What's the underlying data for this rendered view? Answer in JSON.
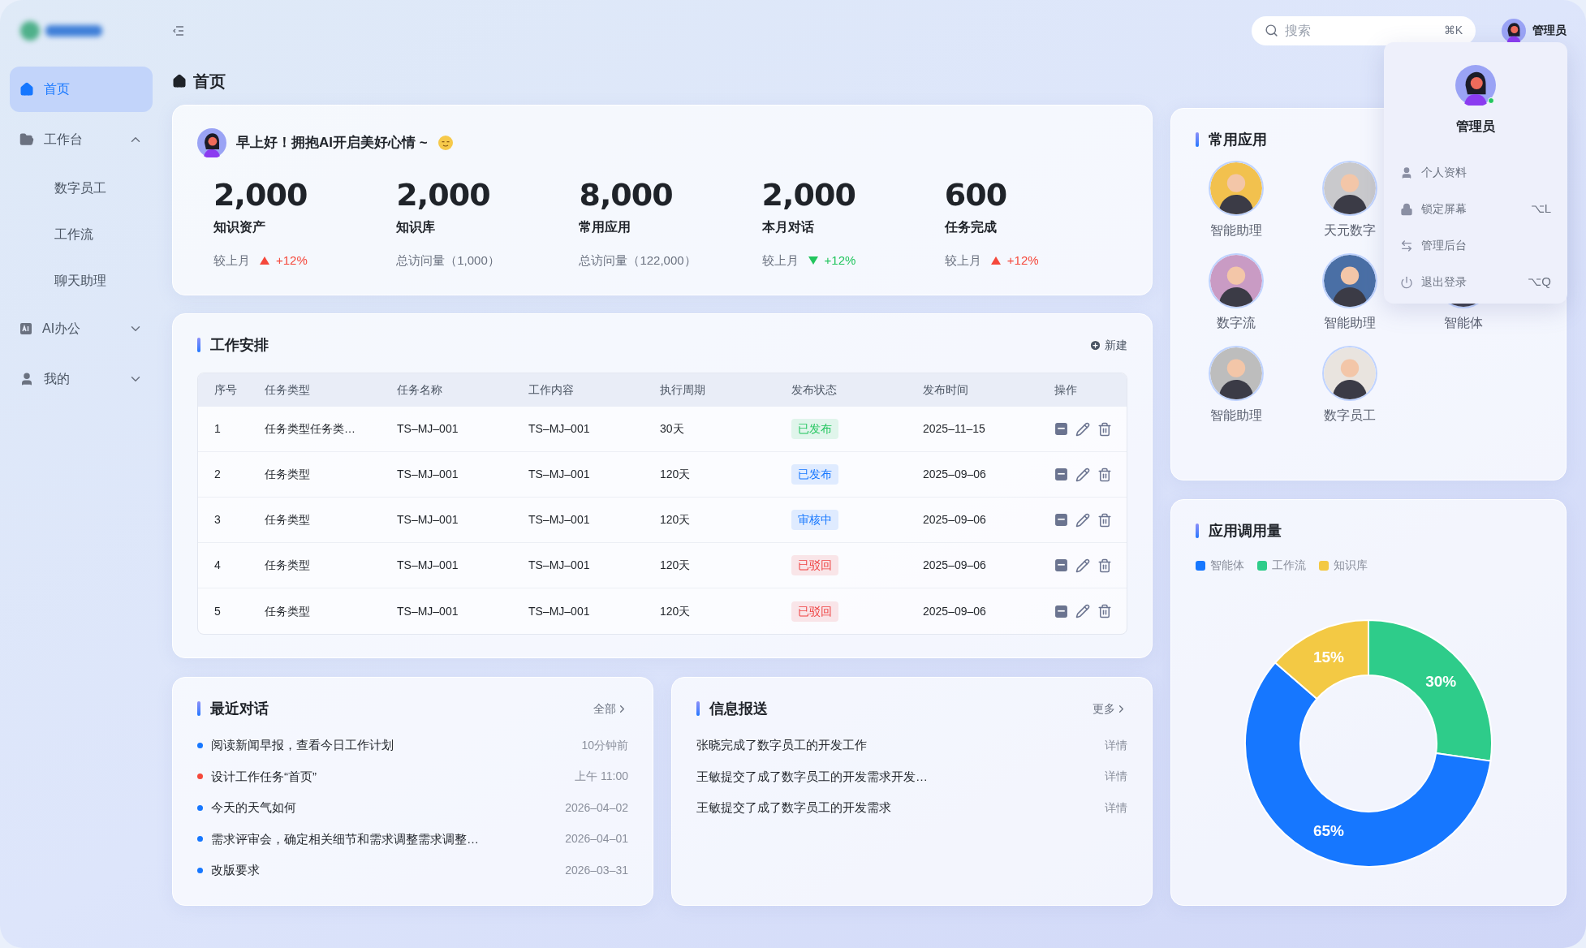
{
  "sidebar": {
    "items": [
      {
        "label": "首页",
        "kind": "home",
        "selected": true
      },
      {
        "label": "工作台",
        "kind": "folder",
        "selected": false,
        "expanded": true,
        "children": [
          {
            "label": "数字员工",
            "selected": false
          },
          {
            "label": "工作流",
            "selected": false
          },
          {
            "label": "聊天助理",
            "selected": false
          }
        ]
      },
      {
        "label": "AI办公",
        "kind": "ai",
        "selected": false,
        "expanded": false
      },
      {
        "label": "我的",
        "kind": "user",
        "selected": false,
        "expanded": false
      }
    ]
  },
  "top_bar": {
    "search": {
      "placeholder": "搜索",
      "shortcut": "⌘K"
    },
    "user": {
      "name": "管理员"
    }
  },
  "page_title": "首页",
  "overview": {
    "greeting": "早上好！拥抱AI开启美好心情 ~",
    "stats": [
      {
        "value": "2,000",
        "label": "知识资产",
        "kind": "trend",
        "prefix": "较上月",
        "rising": true,
        "change": "+12%"
      },
      {
        "value": "2,000",
        "label": "知识库",
        "kind": "note",
        "note": "总访问量（1,000）"
      },
      {
        "value": "8,000",
        "label": "常用应用",
        "kind": "note",
        "note": "总访问量（122,000）"
      },
      {
        "value": "2,000",
        "label": "本月对话",
        "kind": "trend",
        "prefix": "较上月",
        "rising": false,
        "change": "+12%"
      },
      {
        "value": "600",
        "label": "任务完成",
        "kind": "trend",
        "prefix": "较上月",
        "rising": true,
        "change": "+12%"
      }
    ]
  },
  "schedule": {
    "title": "工作安排",
    "new_button": "新建",
    "columns": [
      "序号",
      "任务类型",
      "任务名称",
      "工作内容",
      "执行周期",
      "发布状态",
      "发布时间",
      "操作"
    ],
    "rows": [
      {
        "no": "1",
        "type": "任务类型任务类…",
        "name": "TS–MJ–001",
        "content": "TS–MJ–001",
        "period": "30天",
        "status": "已发布",
        "color": "#22c55e",
        "time": "2025–11–15"
      },
      {
        "no": "2",
        "type": "任务类型",
        "name": "TS–MJ–001",
        "content": "TS–MJ–001",
        "period": "120天",
        "status": "已发布",
        "color": "#1677ff",
        "time": "2025–09–06"
      },
      {
        "no": "3",
        "type": "任务类型",
        "name": "TS–MJ–001",
        "content": "TS–MJ–001",
        "period": "120天",
        "status": "审核中",
        "color": "#1677ff",
        "time": "2025–09–06"
      },
      {
        "no": "4",
        "type": "任务类型",
        "name": "TS–MJ–001",
        "content": "TS–MJ–001",
        "period": "120天",
        "status": "已驳回",
        "color": "#ef4444",
        "time": "2025–09–06"
      },
      {
        "no": "5",
        "type": "任务类型",
        "name": "TS–MJ–001",
        "content": "TS–MJ–001",
        "period": "120天",
        "status": "已驳回",
        "color": "#ef4444",
        "time": "2025–09–06"
      }
    ]
  },
  "recent_chats": {
    "title": "最近对话",
    "more": "全部",
    "items": [
      {
        "text": "阅读新闻早报，查看今日工作计划",
        "time": "10分钟前",
        "color": "#1677ff"
      },
      {
        "text": "设计工作任务“首页”",
        "time": "上午 11:00",
        "color": "#f5483b"
      },
      {
        "text": "今天的天气如何",
        "time": "2026–04–02",
        "color": "#1677ff"
      },
      {
        "text": "需求评审会，确定相关细节和需求调整需求调整…",
        "time": "2026–04–01",
        "color": "#1677ff"
      },
      {
        "text": "改版要求",
        "time": "2026–03–31",
        "color": "#1677ff"
      }
    ]
  },
  "news": {
    "title": "信息报送",
    "more": "更多",
    "items": [
      {
        "text": "张晓完成了数字员工的开发工作",
        "action": "详情"
      },
      {
        "text": "王敏提交了成了数字员工的开发需求开发…",
        "action": "详情"
      },
      {
        "text": "王敏提交了成了数字员工的开发需求",
        "action": "详情"
      }
    ]
  },
  "apps": {
    "title": "常用应用",
    "items": [
      {
        "label": "智能助理"
      },
      {
        "label": "天元数字"
      },
      {
        "label": "数字流"
      },
      {
        "label": "智能助理"
      },
      {
        "label": "智能体"
      },
      {
        "label": "智能助理"
      },
      {
        "label": "数字员工"
      }
    ]
  },
  "usage": {
    "title": "应用调用量",
    "chart_data": {
      "type": "donut",
      "categories": [
        "智能体",
        "工作流",
        "知识库"
      ],
      "values": [
        65,
        30,
        15
      ],
      "colors": [
        "#1677ff",
        "#2ecc8a",
        "#f3c944"
      ],
      "value_labels": [
        "65%",
        "30%",
        "15%"
      ]
    }
  },
  "user_menu": {
    "name": "管理员",
    "items": [
      {
        "label": "个人资料",
        "kind": "user"
      },
      {
        "label": "锁定屏幕",
        "kind": "lock",
        "shortcut": "⌥L"
      },
      {
        "label": "管理后台",
        "kind": "switch"
      },
      {
        "label": "退出登录",
        "kind": "power",
        "shortcut": "⌥Q"
      }
    ]
  }
}
